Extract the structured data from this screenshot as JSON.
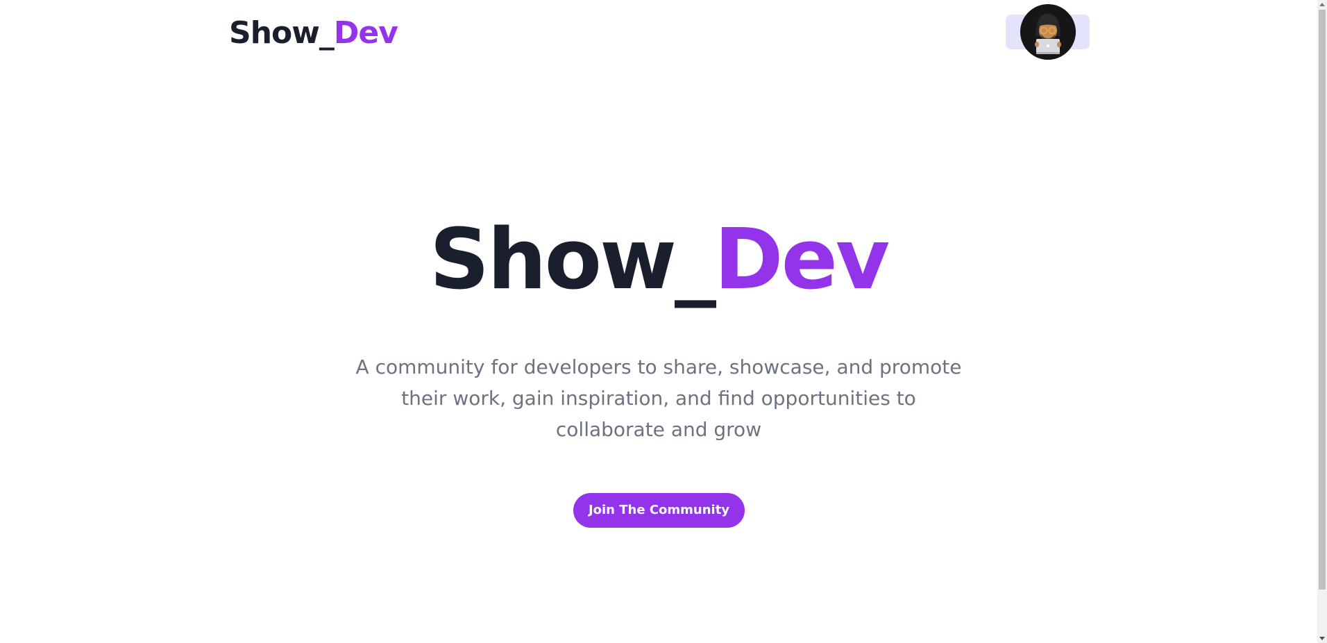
{
  "header": {
    "logo_part1": "Show_",
    "logo_part2": "Dev",
    "avatar_icon": "developer-avatar-icon"
  },
  "hero": {
    "title_part1": "Show_",
    "title_part2": "Dev",
    "description": "A community for developers to share, showcase, and promote their work, gain inspiration, and find opportunities to collaborate and grow",
    "cta_label": "Join The Community"
  },
  "colors": {
    "accent": "#9333ea",
    "dark": "#1a1f2e",
    "muted": "#6b7280",
    "avatar_bg": "#e3e3fb"
  }
}
